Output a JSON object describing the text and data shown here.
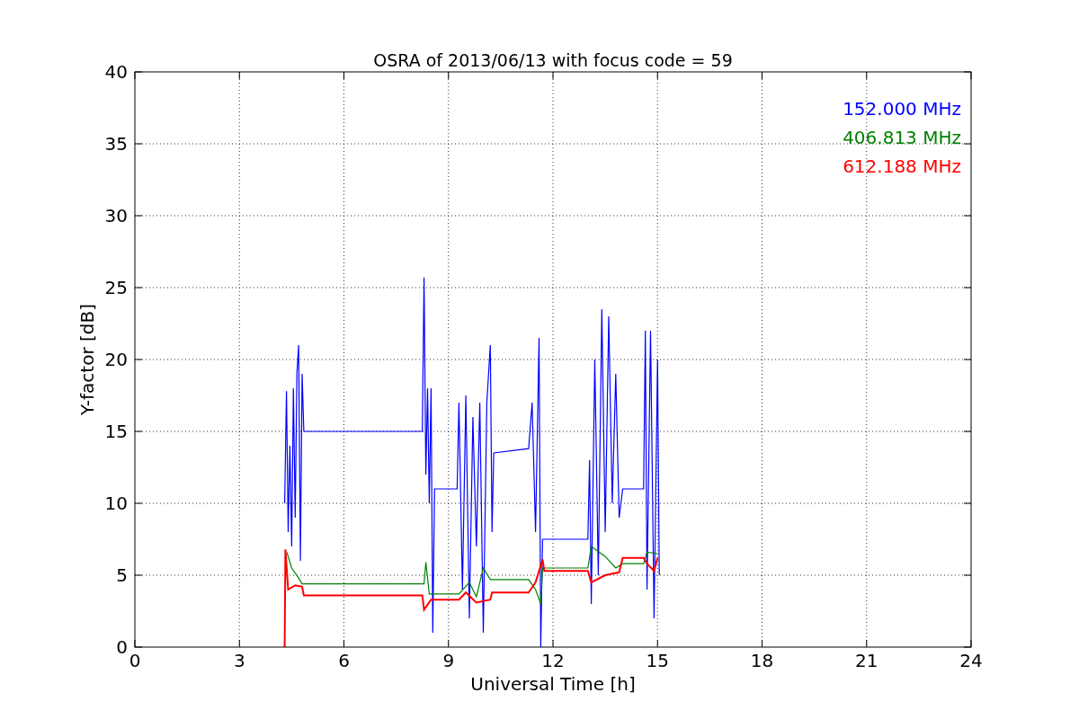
{
  "chart_data": {
    "type": "line",
    "title": "OSRA of 2013/06/13 with focus code = 59",
    "xlabel": "Universal Time [h]",
    "ylabel": "Y-factor [dB]",
    "xlim": [
      0,
      24
    ],
    "ylim": [
      0,
      40
    ],
    "xticks": [
      0,
      3,
      6,
      9,
      12,
      15,
      18,
      21,
      24
    ],
    "yticks": [
      0,
      5,
      10,
      15,
      20,
      25,
      30,
      35,
      40
    ],
    "grid": true,
    "series": [
      {
        "name": "152.000 MHz",
        "color": "#0000ff",
        "x": [
          4.3,
          4.35,
          4.4,
          4.45,
          4.5,
          4.55,
          4.6,
          4.65,
          4.7,
          4.75,
          4.8,
          4.85,
          8.25,
          8.3,
          8.35,
          8.4,
          8.45,
          8.5,
          8.55,
          8.6,
          9.25,
          9.3,
          9.4,
          9.5,
          9.6,
          9.7,
          9.8,
          9.9,
          10.0,
          10.1,
          10.2,
          10.25,
          10.3,
          11.3,
          11.4,
          11.5,
          11.6,
          11.65,
          11.7,
          13.0,
          13.05,
          13.1,
          13.2,
          13.3,
          13.4,
          13.5,
          13.6,
          13.7,
          13.8,
          13.9,
          14.0,
          14.6,
          14.65,
          14.7,
          14.8,
          14.9,
          15.0,
          15.05
        ],
        "values": [
          10,
          17.8,
          8,
          14,
          7,
          18,
          9,
          19,
          21,
          6,
          19,
          15,
          15,
          25.7,
          12,
          18,
          10,
          18,
          1,
          11,
          11,
          17,
          4,
          17.5,
          2,
          16,
          7,
          17,
          1,
          17,
          21,
          8,
          13.5,
          13.8,
          17,
          8,
          21.5,
          0,
          7.5,
          7.5,
          13,
          3,
          20,
          5,
          23.5,
          8,
          23,
          10,
          19,
          9,
          11,
          11,
          22,
          4,
          22,
          2,
          20,
          5
        ]
      },
      {
        "name": "406.813 MHz",
        "color": "#008000",
        "x": [
          4.36,
          4.5,
          4.7,
          4.8,
          8.3,
          8.35,
          8.45,
          9.3,
          9.6,
          9.8,
          10.0,
          10.2,
          11.3,
          11.5,
          11.65,
          11.7,
          13.0,
          13.1,
          13.5,
          13.8,
          14.0,
          14.6,
          14.7,
          15.0
        ],
        "values": [
          6.6,
          5.5,
          4.8,
          4.4,
          4.4,
          5.9,
          3.7,
          3.7,
          4.5,
          3.5,
          5.5,
          4.7,
          4.7,
          4.0,
          3,
          5.5,
          5.5,
          7,
          6.3,
          5.5,
          5.8,
          5.8,
          6.6,
          6.5
        ]
      },
      {
        "name": "612.188 MHz",
        "color": "#ff0000",
        "x": [
          4.3,
          4.32,
          4.4,
          4.6,
          4.8,
          4.85,
          8.25,
          8.3,
          8.5,
          9.3,
          9.5,
          9.8,
          10.2,
          10.25,
          11.3,
          11.5,
          11.7,
          11.75,
          13.0,
          13.1,
          13.5,
          13.9,
          14.0,
          14.6,
          14.7,
          14.9,
          15.0
        ],
        "values": [
          0,
          6.8,
          4.0,
          4.3,
          4.2,
          3.6,
          3.6,
          2.6,
          3.3,
          3.3,
          3.8,
          3.1,
          3.3,
          3.8,
          3.8,
          4.5,
          6.1,
          5.3,
          5.3,
          4.5,
          5,
          5.2,
          6.2,
          6.2,
          5.8,
          5.3,
          6.2
        ]
      }
    ]
  }
}
